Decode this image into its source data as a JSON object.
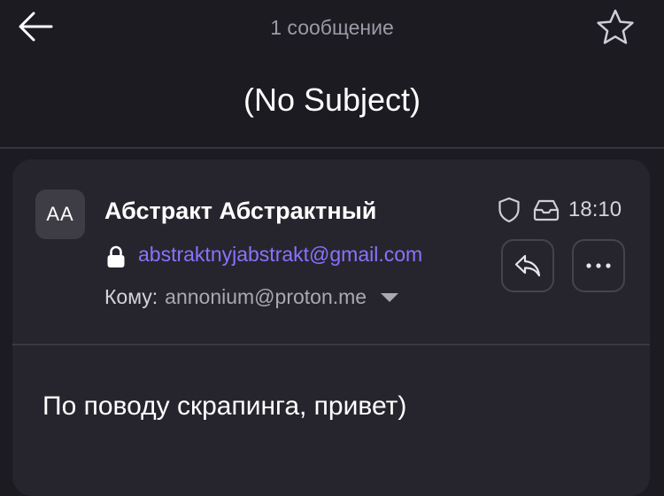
{
  "header": {
    "message_count": "1 сообщение",
    "subject": "(No Subject)"
  },
  "message": {
    "avatar_initials": "AA",
    "sender_name": "Абстракт Абстрактный",
    "sender_email": "abstraktnyjabstrakt@gmail.com",
    "time": "18:10",
    "to_label": "Кому:",
    "to_address": "annonium@proton.me",
    "body": "По поводу скрапинга, привет)"
  },
  "icons": {
    "back": "arrow-left-icon",
    "star": "star-icon",
    "shield": "shield-icon",
    "inbox": "inbox-icon",
    "lock": "lock-icon",
    "reply": "reply-icon",
    "more": "more-icon",
    "caret": "caret-down-icon"
  },
  "colors": {
    "background": "#1c1b22",
    "card": "#26252d",
    "accent_link": "#8c71ff"
  }
}
